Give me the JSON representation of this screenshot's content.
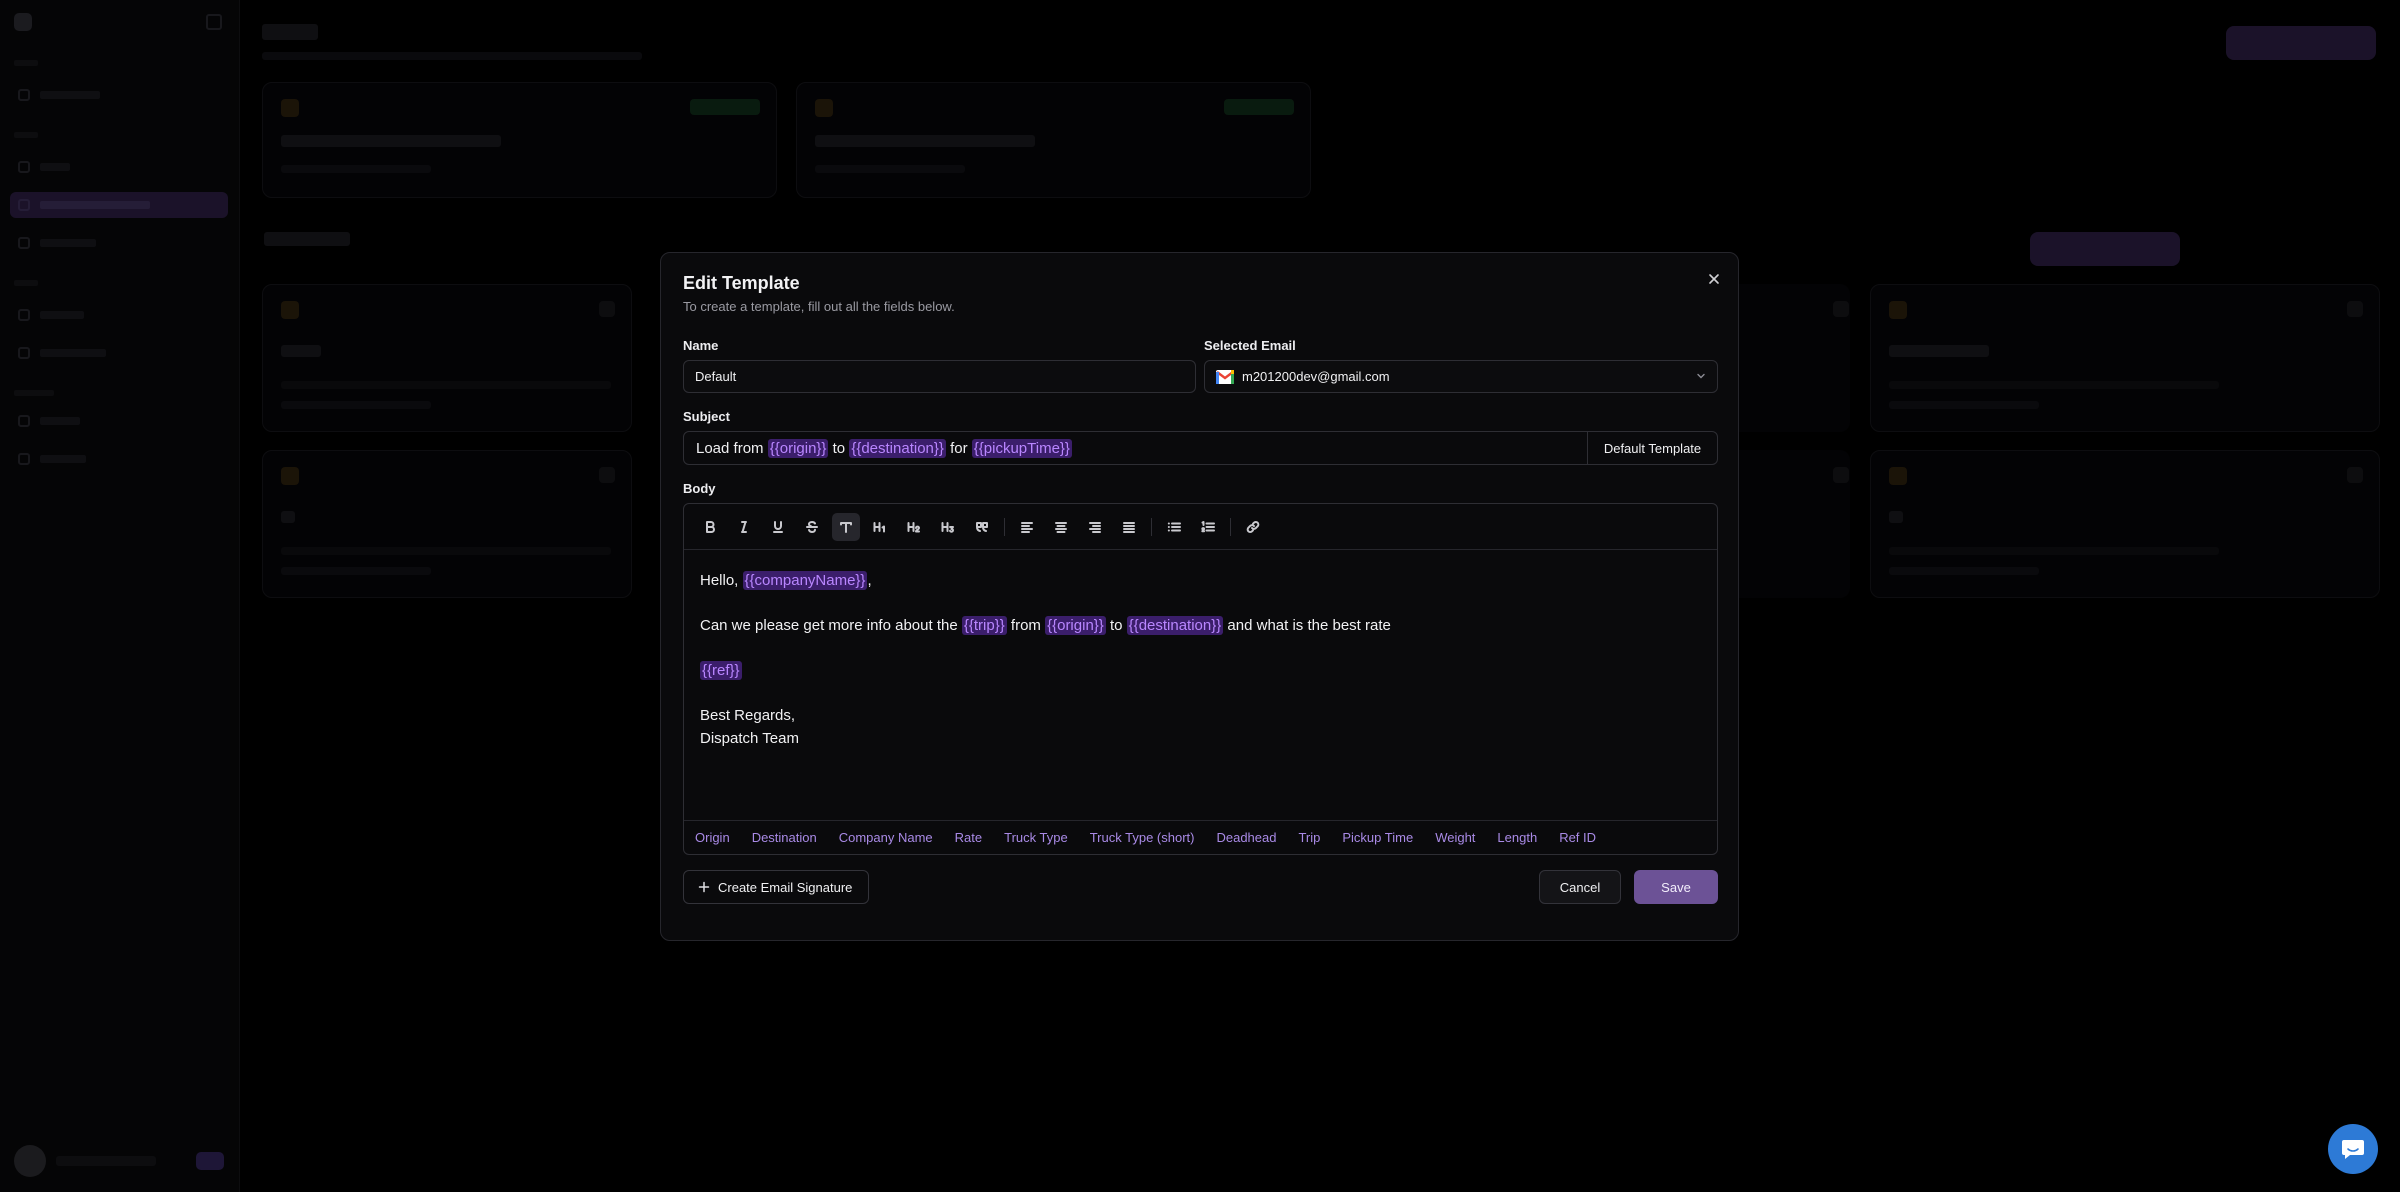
{
  "modal": {
    "title": "Edit Template",
    "subtitle": "To create a template, fill out all the fields below.",
    "close_icon": "close-icon",
    "name": {
      "label": "Name",
      "value": "Default"
    },
    "selected_email": {
      "label": "Selected Email",
      "value": "m201200dev@gmail.com",
      "icon": "gmail-icon"
    },
    "subject": {
      "label": "Subject",
      "parts": [
        "Load from ",
        "{{origin}}",
        " to ",
        "{{destination}}",
        " for ",
        "{{pickupTime}}"
      ],
      "default_template_label": "Default Template"
    },
    "body": {
      "label": "Body",
      "toolbar": [
        "bold-icon",
        "italic-icon",
        "underline-icon",
        "strikethrough-icon",
        "paragraph-icon",
        "heading-1-icon",
        "heading-2-icon",
        "heading-3-icon",
        "quote-icon",
        "align-left-icon",
        "align-center-icon",
        "align-right-icon",
        "align-justify-icon",
        "bullet-list-icon",
        "ordered-list-icon",
        "link-icon"
      ],
      "line1": {
        "text": "Hello, ",
        "token": "{{companyName}}",
        "end": ","
      },
      "line2": {
        "a": "Can we please get more info about the ",
        "t1": "{{trip}}",
        "b": " from ",
        "t2": "{{origin}}",
        "c": " to ",
        "t3": "{{destination}}",
        "d": " and what is the best rate"
      },
      "line3": {
        "token": "{{ref}}"
      },
      "line4": "Best Regards,",
      "line5": "Dispatch Team"
    },
    "variables": [
      "Origin",
      "Destination",
      "Company Name",
      "Rate",
      "Truck Type",
      "Truck Type (short)",
      "Deadhead",
      "Trip",
      "Pickup Time",
      "Weight",
      "Length",
      "Ref ID"
    ],
    "create_signature_label": "Create Email Signature",
    "cancel_label": "Cancel",
    "save_label": "Save"
  },
  "colors": {
    "accent": "#6c5296",
    "token_bg": "#3b1e6b",
    "token_fg": "#b986ff",
    "chat_button": "#2d7ad6"
  }
}
